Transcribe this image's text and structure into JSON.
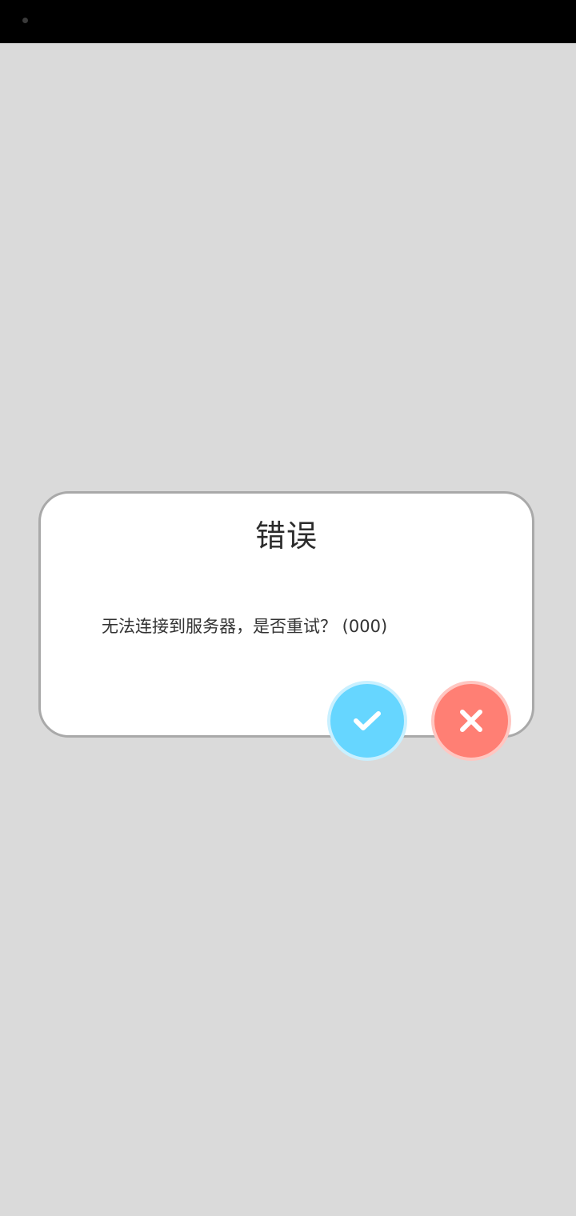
{
  "dialog": {
    "title": "错误",
    "message": "无法连接到服务器，是否重试？ (000)"
  },
  "buttons": {
    "confirm": {
      "icon": "check-icon",
      "color": "#66d6ff"
    },
    "cancel": {
      "icon": "close-icon",
      "color": "#ff7f74"
    }
  },
  "colors": {
    "background": "#dadada",
    "dialog_border": "#a9a9a9",
    "status_bar": "#000000"
  }
}
